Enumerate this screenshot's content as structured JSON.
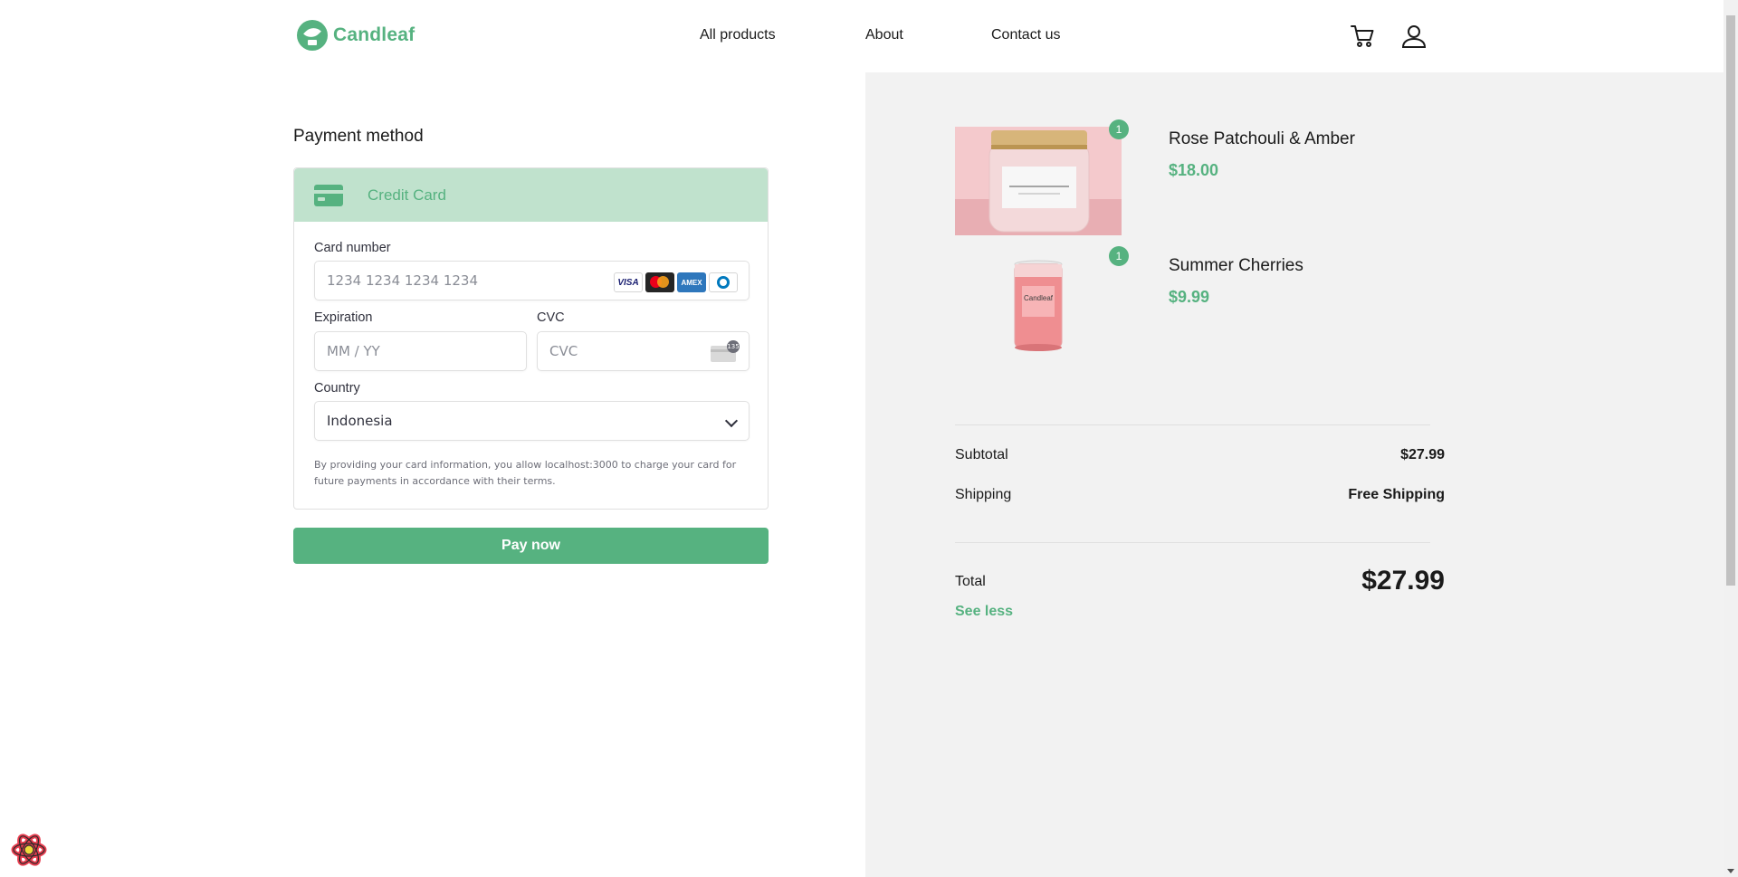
{
  "brand": {
    "name": "Candleaf",
    "accent": "#56b280"
  },
  "nav": {
    "all_products": "All products",
    "about": "About",
    "contact": "Contact us"
  },
  "header_icons": [
    "cart-icon",
    "user-icon"
  ],
  "payment": {
    "title": "Payment method",
    "method_label": "Credit Card",
    "card_number": {
      "label": "Card number",
      "placeholder": "1234 1234 1234 1234",
      "value": ""
    },
    "card_brands": [
      "VISA",
      "Mastercard",
      "AMEX",
      "Diners"
    ],
    "expiration": {
      "label": "Expiration",
      "placeholder": "MM / YY",
      "value": ""
    },
    "cvc": {
      "label": "CVC",
      "placeholder": "CVC",
      "value": "",
      "hint": "135"
    },
    "country": {
      "label": "Country",
      "value": "Indonesia"
    },
    "terms": "By providing your card information, you allow localhost:3000 to charge your card for future payments in accordance with their terms.",
    "pay_button": "Pay now"
  },
  "summary": {
    "items": [
      {
        "name": "Rose Patchouli & Amber",
        "price": "$18.00",
        "qty": "1"
      },
      {
        "name": "Summer Cherries",
        "price": "$9.99",
        "qty": "1"
      }
    ],
    "subtotal_label": "Subtotal",
    "subtotal": "$27.99",
    "shipping_label": "Shipping",
    "shipping": "Free Shipping",
    "total_label": "Total",
    "total": "$27.99",
    "see_less": "See less"
  }
}
